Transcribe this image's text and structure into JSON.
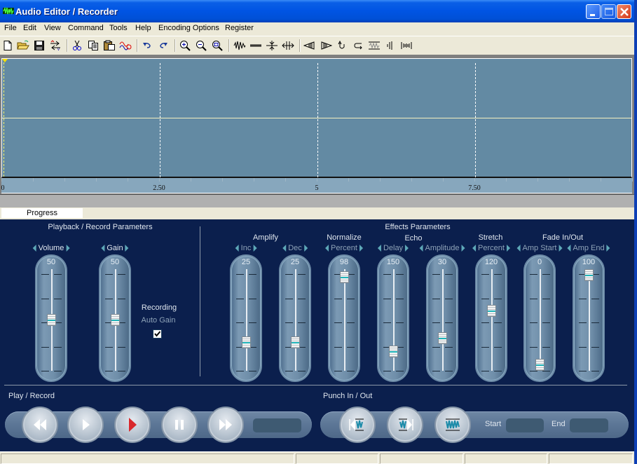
{
  "window": {
    "title": "Audio Editor / Recorder",
    "controls": [
      "minimize",
      "maximize",
      "close"
    ]
  },
  "menu": [
    "File",
    "Edit",
    "View",
    "Command",
    "Tools",
    "Help",
    "Encoding Options",
    "Register"
  ],
  "toolbar": {
    "groups": [
      [
        "new-file-icon",
        "open-folder-icon",
        "save-icon",
        "convert-icon"
      ],
      [
        "cut-icon",
        "copy-icon",
        "paste-icon",
        "mix-paste-icon"
      ],
      [
        "undo-icon",
        "redo-icon"
      ],
      [
        "zoom-in-icon",
        "zoom-out-icon",
        "zoom-fit-icon"
      ],
      [
        "waveform-icon",
        "silence-icon",
        "contract-icon",
        "expand-icon"
      ],
      [
        "fade-out-icon",
        "fade-in-icon",
        "reverse-icon",
        "loop-icon",
        "noise-icon",
        "insert-icon",
        "trim-icon"
      ]
    ]
  },
  "waveform": {
    "ruler_labels": [
      "0",
      "2.50",
      "5",
      "7.50"
    ],
    "ruler_values": [
      0,
      2.5,
      5,
      7.5
    ],
    "visible_range_seconds": [
      0,
      10
    ],
    "cursor_position_seconds": 0
  },
  "progress": {
    "label": "Progress"
  },
  "playback_params": {
    "title": "Playback / Record Parameters",
    "sliders": [
      {
        "label": "Volume",
        "value": "50",
        "fraction": 0.5
      },
      {
        "label": "Gain",
        "value": "50",
        "fraction": 0.5
      }
    ],
    "recording_label": "Recording",
    "auto_gain_label": "Auto Gain",
    "auto_gain_checked": true
  },
  "effects_params": {
    "title": "Effects Parameters",
    "groups": [
      {
        "title": "Amplify"
      },
      {
        "title": "Normalize"
      },
      {
        "title": "Echo"
      },
      {
        "title": "Stretch"
      },
      {
        "title": "Fade In/Out"
      }
    ],
    "sliders": [
      {
        "label": "Inc",
        "value": "25",
        "fraction": 0.25
      },
      {
        "label": "Dec",
        "value": "25",
        "fraction": 0.25
      },
      {
        "label": "Percent",
        "value": "98",
        "fraction": 0.98
      },
      {
        "label": "Delay",
        "value": "150",
        "fraction": 0.15
      },
      {
        "label": "Amplitude",
        "value": "30",
        "fraction": 0.3
      },
      {
        "label": "Percent",
        "value": "120",
        "fraction": 0.6
      },
      {
        "label": "Amp Start",
        "value": "0",
        "fraction": 0.0
      },
      {
        "label": "Amp End",
        "value": "100",
        "fraction": 1.0
      }
    ]
  },
  "play_record": {
    "title": "Play / Record",
    "buttons": [
      "rewind",
      "play",
      "record",
      "pause",
      "fast-forward"
    ],
    "time_display": ""
  },
  "punch": {
    "title": "Punch In / Out",
    "buttons": [
      "punch-in",
      "punch-out",
      "punch-region"
    ],
    "start_label": "Start",
    "start_value": "",
    "end_label": "End",
    "end_value": ""
  },
  "status_bar": [
    "",
    "",
    "",
    "",
    ""
  ],
  "colors": {
    "panel_bg": "#0b1f4d",
    "waveform_bg": "#638aa3",
    "record_red": "#d8282c",
    "thumb_accent": "#1fb3b8"
  }
}
